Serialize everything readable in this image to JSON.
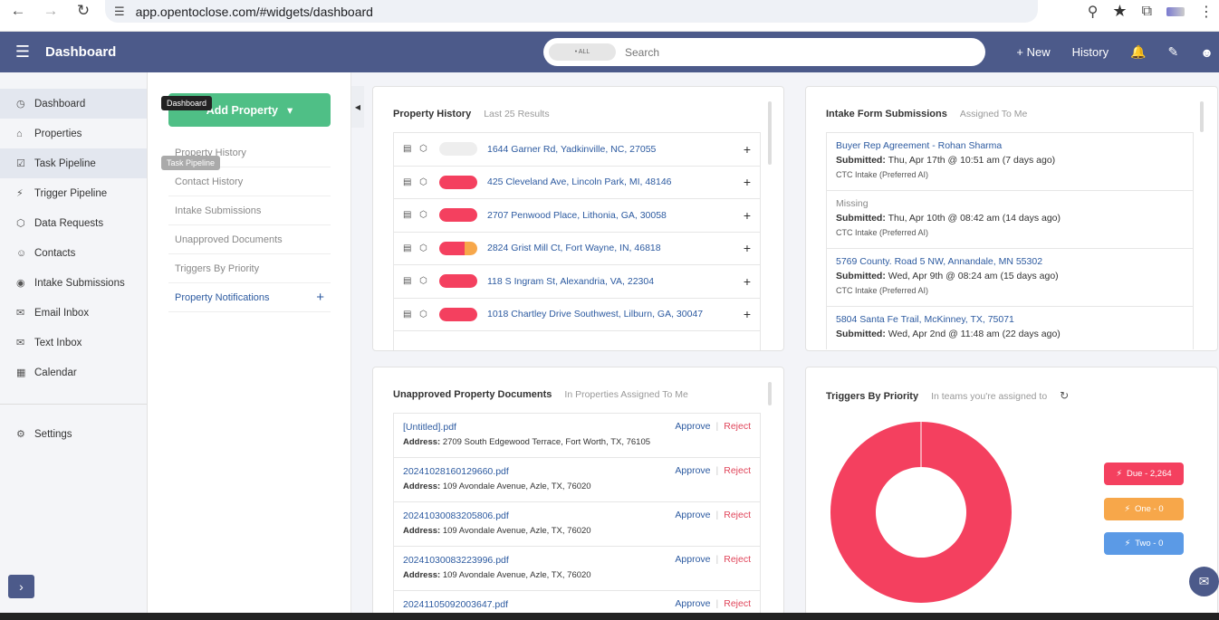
{
  "browser": {
    "url": "app.opentoclose.com/#widgets/dashboard"
  },
  "header": {
    "title": "Dashboard",
    "search_scope": "• ALL",
    "search_placeholder": "Search",
    "new_label": "+ New",
    "history_label": "History"
  },
  "sidebar": {
    "items": [
      {
        "label": "Dashboard",
        "icon": "dashboard-icon"
      },
      {
        "label": "Properties",
        "icon": "home-icon"
      },
      {
        "label": "Task Pipeline",
        "icon": "checkbox-icon"
      },
      {
        "label": "Trigger Pipeline",
        "icon": "bolt-icon"
      },
      {
        "label": "Data Requests",
        "icon": "cube-icon"
      },
      {
        "label": "Contacts",
        "icon": "contact-icon"
      },
      {
        "label": "Intake Submissions",
        "icon": "intake-icon"
      },
      {
        "label": "Email Inbox",
        "icon": "envelope-icon"
      },
      {
        "label": "Text Inbox",
        "icon": "chat-icon"
      },
      {
        "label": "Calendar",
        "icon": "calendar-icon"
      }
    ],
    "settings_label": "Settings",
    "tooltip_dashboard": "Dashboard",
    "tooltip_task": "Task Pipeline"
  },
  "subnav": {
    "add_property_label": "Add Property",
    "items": [
      "Property History",
      "Contact History",
      "Intake Submissions",
      "Unapproved Documents",
      "Triggers By Priority",
      "Property Notifications"
    ]
  },
  "property_history": {
    "title": "Property History",
    "subtitle": "Last 25 Results",
    "rows": [
      {
        "address": "1644 Garner Rd, Yadkinville, NC, 27055",
        "status": "grey"
      },
      {
        "address": "425 Cleveland Ave, Lincoln Park, MI, 48146",
        "status": "red"
      },
      {
        "address": "2707 Penwood Place, Lithonia, GA, 30058",
        "status": "red"
      },
      {
        "address": "2824 Grist Mill Ct, Fort Wayne, IN, 46818",
        "status": "split"
      },
      {
        "address": "118 S Ingram St, Alexandria, VA, 22304",
        "status": "red"
      },
      {
        "address": "1018 Chartley Drive Southwest, Lilburn, GA, 30047",
        "status": "red"
      }
    ]
  },
  "intake": {
    "title": "Intake Form Submissions",
    "subtitle": "Assigned To Me",
    "submitted_label": "Submitted:",
    "rows": [
      {
        "title": "Buyer Rep Agreement - Rohan Sharma",
        "submitted": "Thu, Apr 17th @ 10:51 am (7 days ago)",
        "form": "CTC Intake (Preferred AI)",
        "missing": false
      },
      {
        "title": "Missing",
        "submitted": "Thu, Apr 10th @ 08:42 am (14 days ago)",
        "form": "CTC Intake (Preferred AI)",
        "missing": true
      },
      {
        "title": "5769 County. Road 5 NW, Annandale, MN 55302",
        "submitted": "Wed, Apr 9th @ 08:24 am (15 days ago)",
        "form": "CTC Intake (Preferred AI)",
        "missing": false
      },
      {
        "title": "5804 Santa Fe Trail, McKinney, TX, 75071",
        "submitted": "Wed, Apr 2nd @ 11:48 am (22 days ago)",
        "form": "",
        "missing": false
      }
    ]
  },
  "unapproved": {
    "title": "Unapproved Property Documents",
    "subtitle": "In Properties Assigned To Me",
    "address_label": "Address:",
    "approve_label": "Approve",
    "reject_label": "Reject",
    "rows": [
      {
        "file": "[Untitled].pdf",
        "address": "2709 South Edgewood Terrace, Fort Worth, TX, 76105"
      },
      {
        "file": "20241028160129660.pdf",
        "address": "109 Avondale Avenue, Azle, TX, 76020"
      },
      {
        "file": "20241030083205806.pdf",
        "address": "109 Avondale Avenue, Azle, TX, 76020"
      },
      {
        "file": "20241030083223996.pdf",
        "address": "109 Avondale Avenue, Azle, TX, 76020"
      },
      {
        "file": "20241105092003647.pdf",
        "address": ""
      }
    ]
  },
  "triggers": {
    "title": "Triggers By Priority",
    "subtitle": "In teams you're assigned to",
    "legend": [
      {
        "label": "Due - 2,264",
        "value": 2264,
        "color": "#f4405f"
      },
      {
        "label": "One - 0",
        "value": 0,
        "color": "#f7a74a"
      },
      {
        "label": "Two - 0",
        "value": 0,
        "color": "#5b9ae6"
      }
    ]
  },
  "chart_data": {
    "type": "pie",
    "categories": [
      "Due",
      "One",
      "Two"
    ],
    "values": [
      2264,
      0,
      0
    ],
    "title": "Triggers By Priority",
    "colors": [
      "#f4405f",
      "#f7a74a",
      "#5b9ae6"
    ],
    "legend": "right"
  }
}
